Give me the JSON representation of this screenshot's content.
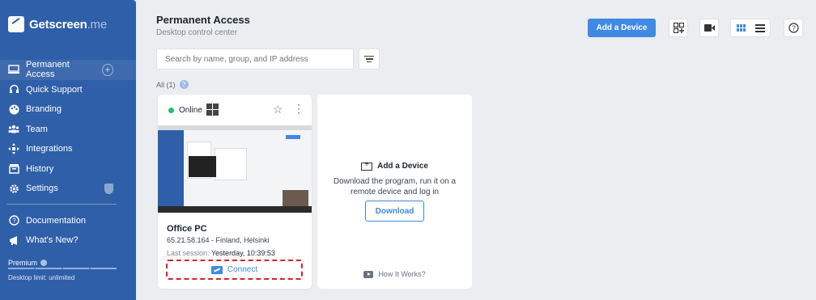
{
  "app": {
    "brand": "Getscreen",
    "brand_tld": ".me"
  },
  "sidebar": {
    "items": [
      {
        "label": "Permanent Access",
        "icon": "monitor-icon"
      },
      {
        "label": "Quick Support",
        "icon": "headset-icon"
      },
      {
        "label": "Branding",
        "icon": "palette-icon"
      },
      {
        "label": "Team",
        "icon": "team-icon"
      },
      {
        "label": "Integrations",
        "icon": "integrations-icon"
      },
      {
        "label": "History",
        "icon": "history-icon"
      },
      {
        "label": "Settings",
        "icon": "gear-icon"
      }
    ],
    "secondary": [
      {
        "label": "Documentation",
        "icon": "question-icon"
      },
      {
        "label": "What's New?",
        "icon": "megaphone-icon"
      }
    ],
    "premium_label": "Premium",
    "limit_text": "Desktop limit: unlimited"
  },
  "header": {
    "title": "Permanent Access",
    "subtitle": "Desktop control center",
    "add_button": "Add a Device"
  },
  "search": {
    "placeholder": "Search by name, group, and IP address"
  },
  "filter_label": "All (1)",
  "device": {
    "status": "Online",
    "name": "Office PC",
    "ip_location": "65.21.58.164 - Finland, Helsinki",
    "last_session_label": "Last session:",
    "last_session_value": "Yesterday, 10:39:53",
    "connect_label": "Connect"
  },
  "add_card": {
    "title": "Add a Device",
    "description": "Download the program, run it on a remote device and log in",
    "download_label": "Download",
    "how_label": "How It Works?"
  },
  "colors": {
    "sidebar": "#2f5fa8",
    "accent": "#3f8ae4",
    "online": "#2dbd74",
    "highlight": "#d3262b"
  }
}
